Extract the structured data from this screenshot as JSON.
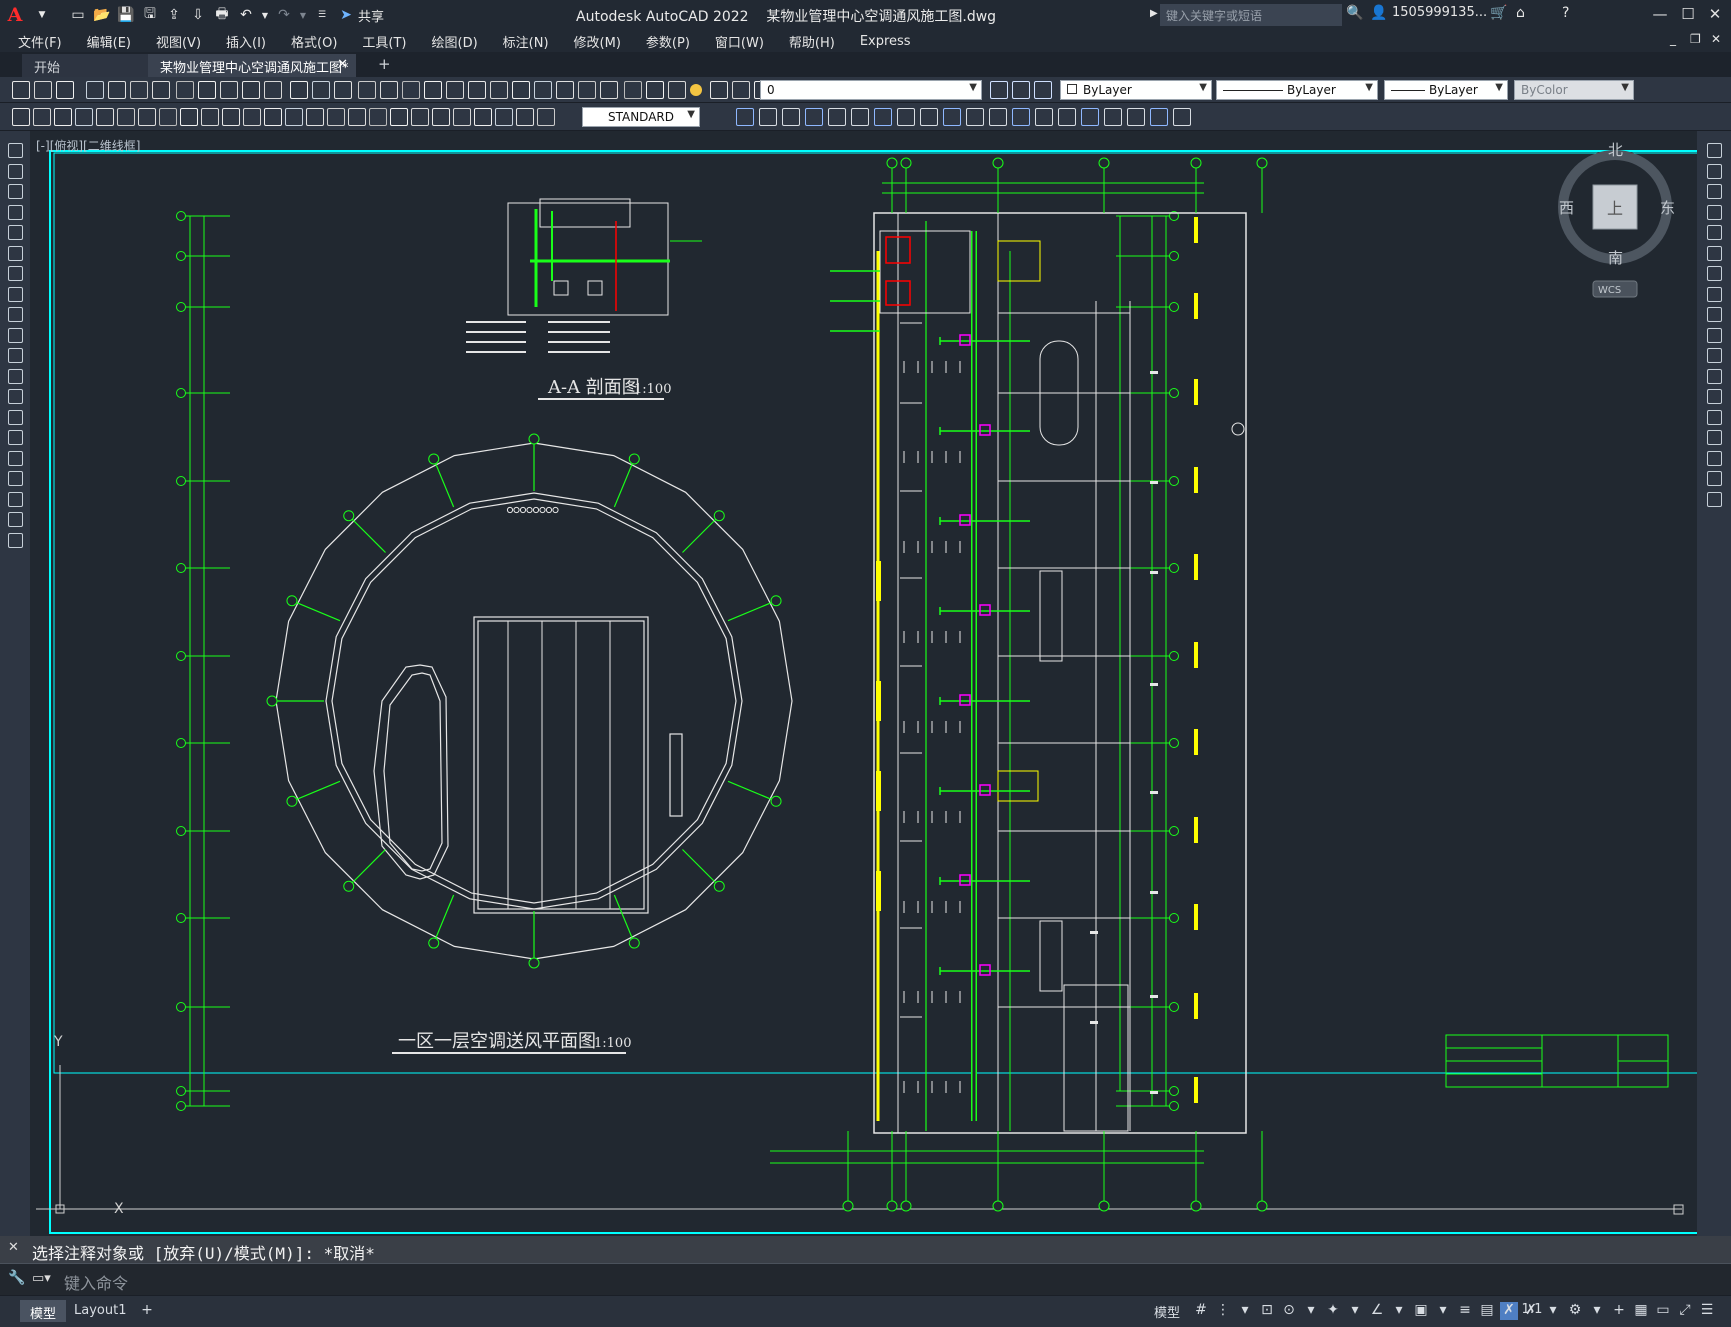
{
  "titlebar": {
    "app_name": "Autodesk AutoCAD 2022",
    "file_name": "某物业管理中心空调通风施工图.dwg",
    "share_label": "共享",
    "search_placeholder": "键入关键字或短语",
    "user": "1505999135..."
  },
  "menu": [
    "文件(F)",
    "编辑(E)",
    "视图(V)",
    "插入(I)",
    "格式(O)",
    "工具(T)",
    "绘图(D)",
    "标注(N)",
    "修改(M)",
    "参数(P)",
    "窗口(W)",
    "帮助(H)",
    "Express"
  ],
  "file_tabs": {
    "start": "开始",
    "current": "某物业管理中心空调通风施工图*",
    "add": "+"
  },
  "toolbar": {
    "layer_value": "0",
    "color": "ByLayer",
    "linetype": "ByLayer",
    "lineweight": "ByLayer",
    "plotstyle": "ByColor",
    "textstyle": "STANDARD"
  },
  "viewport_label": "[-][俯视][二维线框]",
  "viewcube": {
    "north": "北",
    "south": "南",
    "east": "东",
    "west": "西",
    "top": "上",
    "wcs": "WCS"
  },
  "drawing": {
    "section_title": "A-A 剖面图",
    "section_scale": "1:100",
    "plan_title": "一区一层空调送风平面图",
    "plan_scale": "1:100",
    "ucs_y": "Y",
    "ucs_x": "X"
  },
  "command": {
    "history": "选择注释对象或 [放弃(U)/模式(M)]: *取消*",
    "placeholder": "键入命令"
  },
  "status": {
    "model_tab": "模型",
    "layout_tab": "Layout1",
    "model_label": "模型",
    "scale": "1:1"
  },
  "colors": {
    "canvas": "#212830",
    "green": "#19ff19",
    "yellow": "#ffff00",
    "cyan": "#00ffff",
    "magenta": "#ff00ff",
    "red": "#ff0000"
  }
}
